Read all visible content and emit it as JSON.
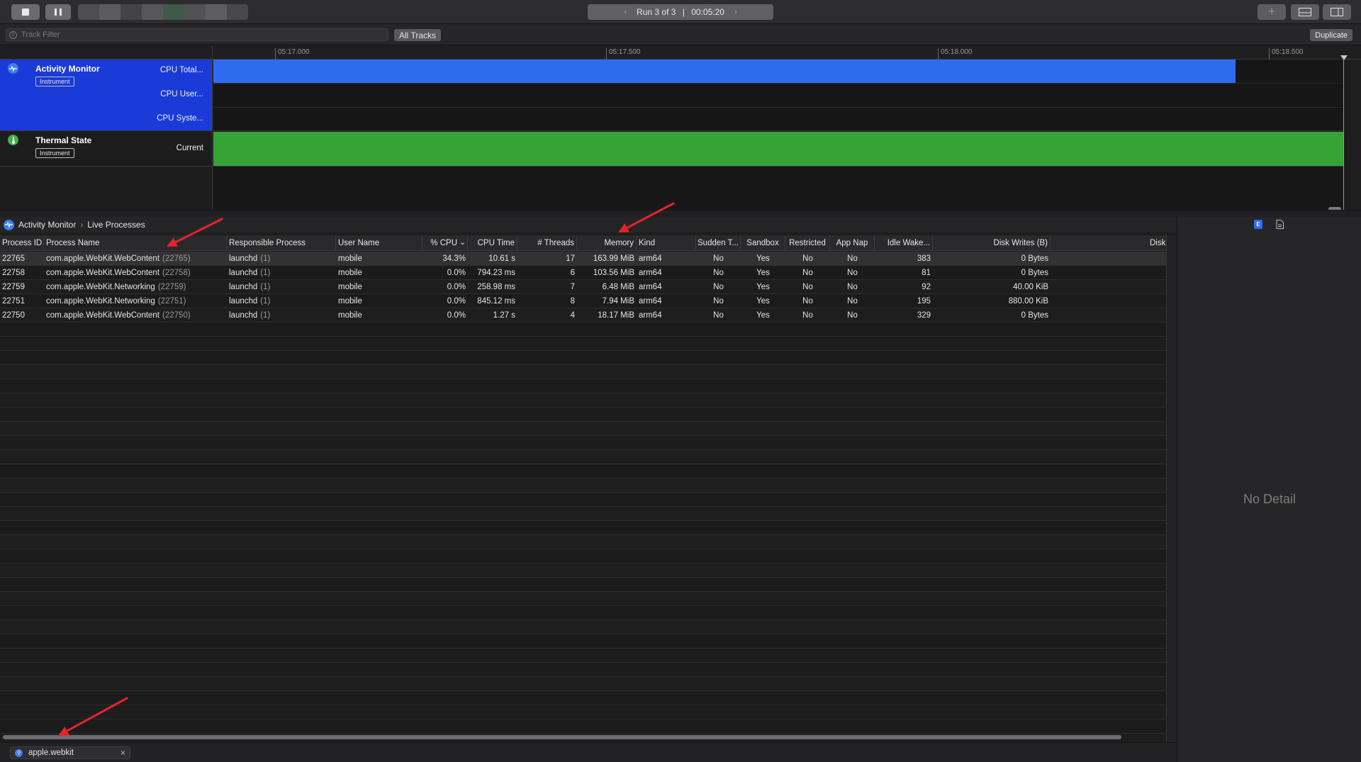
{
  "toolbar": {
    "run_label": "Run 3 of 3",
    "run_separator": "|",
    "elapsed": "00:05:20",
    "prev_chevron": "‹",
    "next_chevron": "›",
    "add_glyph": "+"
  },
  "filter_row": {
    "placeholder": "Track Filter",
    "all_tracks_label": "All Tracks",
    "duplicate_label": "Duplicate"
  },
  "ruler": {
    "ticks": [
      "05:17.000",
      "05:17.500",
      "05:18.000",
      "05:18.500"
    ]
  },
  "tracks": [
    {
      "title": "Activity Monitor",
      "badge": "Instrument",
      "icon": "activity-monitor-icon",
      "lanes": [
        "CPU Total...",
        "CPU User...",
        "CPU Syste..."
      ],
      "color": "#2f6bf1"
    },
    {
      "title": "Thermal State",
      "badge": "Instrument",
      "icon": "thermometer-icon",
      "lanes": [
        "Current"
      ],
      "color": "#36a336"
    }
  ],
  "breadcrumb": {
    "instrument": "Activity Monitor",
    "view": "Live Processes"
  },
  "table": {
    "columns": [
      "Process ID",
      "Process Name",
      "Responsible Process",
      "User Name",
      "% CPU",
      "CPU Time",
      "# Threads",
      "Memory",
      "Kind",
      "Sudden T...",
      "Sandbox",
      "Restricted",
      "App Nap",
      "Idle Wake...",
      "Disk Writes (B)",
      "Disk R"
    ],
    "sort_indicator": "⌄",
    "rows": [
      {
        "pid": "22765",
        "name": "com.apple.WebKit.WebContent",
        "name_pid": "(22765)",
        "resp": "launchd",
        "resp_pid": "(1)",
        "user": "mobile",
        "cpu": "34.3%",
        "cpu_time": "10.61 s",
        "threads": "17",
        "memory": "163.99 MiB",
        "kind": "arm64",
        "sudden": "No",
        "sandbox": "Yes",
        "restricted": "No",
        "app_nap": "No",
        "idle_wake": "383",
        "disk_writes": "0 Bytes"
      },
      {
        "pid": "22758",
        "name": "com.apple.WebKit.WebContent",
        "name_pid": "(22758)",
        "resp": "launchd",
        "resp_pid": "(1)",
        "user": "mobile",
        "cpu": "0.0%",
        "cpu_time": "794.23 ms",
        "threads": "6",
        "memory": "103.56 MiB",
        "kind": "arm64",
        "sudden": "No",
        "sandbox": "Yes",
        "restricted": "No",
        "app_nap": "No",
        "idle_wake": "81",
        "disk_writes": "0 Bytes"
      },
      {
        "pid": "22759",
        "name": "com.apple.WebKit.Networking",
        "name_pid": "(22759)",
        "resp": "launchd",
        "resp_pid": "(1)",
        "user": "mobile",
        "cpu": "0.0%",
        "cpu_time": "258.98 ms",
        "threads": "7",
        "memory": "6.48 MiB",
        "kind": "arm64",
        "sudden": "No",
        "sandbox": "Yes",
        "restricted": "No",
        "app_nap": "No",
        "idle_wake": "92",
        "disk_writes": "40.00 KiB"
      },
      {
        "pid": "22751",
        "name": "com.apple.WebKit.Networking",
        "name_pid": "(22751)",
        "resp": "launchd",
        "resp_pid": "(1)",
        "user": "mobile",
        "cpu": "0.0%",
        "cpu_time": "845.12 ms",
        "threads": "8",
        "memory": "7.94 MiB",
        "kind": "arm64",
        "sudden": "No",
        "sandbox": "Yes",
        "restricted": "No",
        "app_nap": "No",
        "idle_wake": "195",
        "disk_writes": "880.00 KiB"
      },
      {
        "pid": "22750",
        "name": "com.apple.WebKit.WebContent",
        "name_pid": "(22750)",
        "resp": "launchd",
        "resp_pid": "(1)",
        "user": "mobile",
        "cpu": "0.0%",
        "cpu_time": "1.27 s",
        "threads": "4",
        "memory": "18.17 MiB",
        "kind": "arm64",
        "sudden": "No",
        "sandbox": "Yes",
        "restricted": "No",
        "app_nap": "No",
        "idle_wake": "329",
        "disk_writes": "0 Bytes"
      }
    ]
  },
  "detail": {
    "empty_text": "No Detail"
  },
  "bottom_filter": {
    "token": "apple.webkit",
    "close_glyph": "×"
  },
  "colors": {
    "selection_blue": "#1a3bd8",
    "cpu_bar": "#2f6bf1",
    "thermal_bar": "#36a336",
    "annotation_arrow": "#e3242b"
  }
}
